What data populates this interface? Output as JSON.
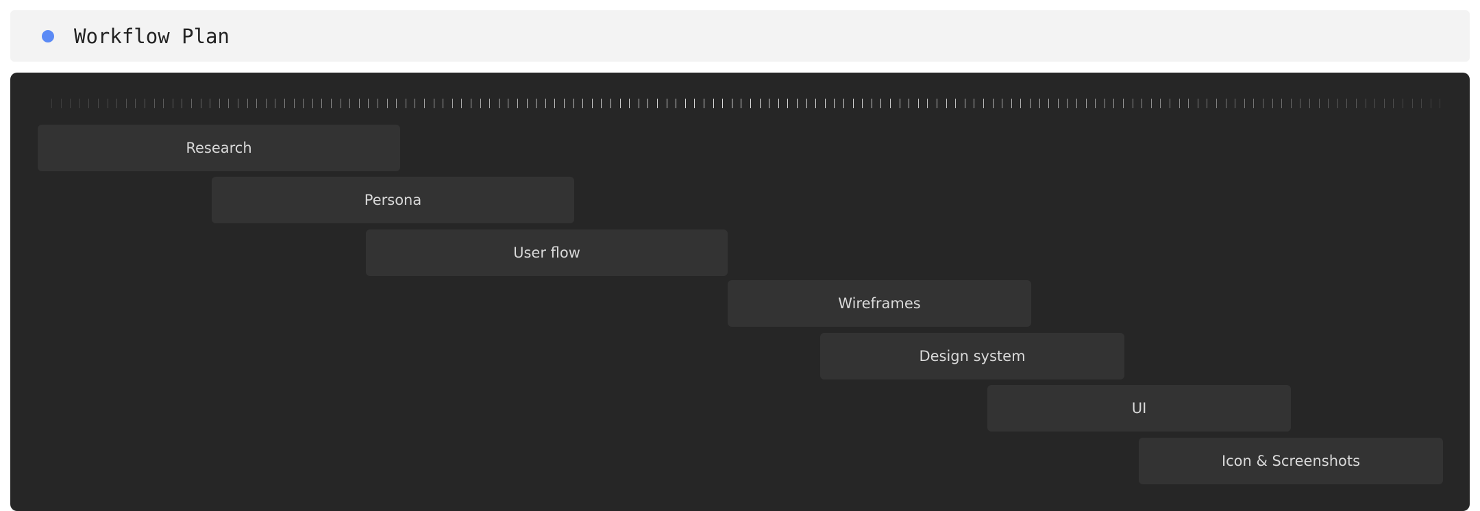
{
  "header": {
    "title": "Workflow Plan",
    "status_color": "#5b8af5"
  },
  "board": {
    "background": "#262626",
    "tasks": [
      {
        "label": "Research"
      },
      {
        "label": "Persona"
      },
      {
        "label": "User flow"
      },
      {
        "label": "Wireframes"
      },
      {
        "label": "Design system"
      },
      {
        "label": "UI"
      },
      {
        "label": "Icon & Screenshots"
      }
    ]
  }
}
